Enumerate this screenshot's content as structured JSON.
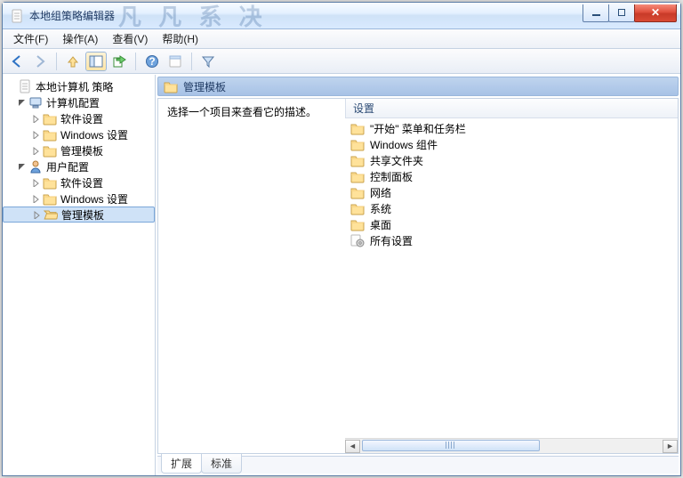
{
  "window": {
    "title": "本地组策略编辑器"
  },
  "menu": {
    "file": "文件(F)",
    "action": "操作(A)",
    "view": "查看(V)",
    "help": "帮助(H)"
  },
  "tree": {
    "root": "本地计算机 策略",
    "computer_cfg": "计算机配置",
    "user_cfg": "用户配置",
    "software": "软件设置",
    "windows": "Windows 设置",
    "admin_templates": "管理模板"
  },
  "header": {
    "title": "管理模板"
  },
  "description": "选择一个项目来查看它的描述。",
  "column_header": "设置",
  "items": [
    {
      "label": "\"开始\" 菜单和任务栏",
      "icon": "folder"
    },
    {
      "label": "Windows 组件",
      "icon": "folder"
    },
    {
      "label": "共享文件夹",
      "icon": "folder"
    },
    {
      "label": "控制面板",
      "icon": "folder"
    },
    {
      "label": "网络",
      "icon": "folder"
    },
    {
      "label": "系统",
      "icon": "folder"
    },
    {
      "label": "桌面",
      "icon": "folder"
    },
    {
      "label": "所有设置",
      "icon": "settings"
    }
  ],
  "tabs": {
    "extended": "扩展",
    "standard": "标准"
  },
  "ghost_text": "凡 凡 系 决"
}
